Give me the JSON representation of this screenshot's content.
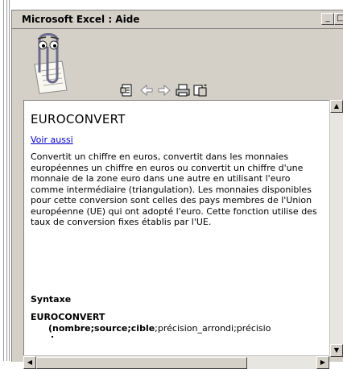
{
  "window": {
    "title": "Microsoft Excel : Aide"
  },
  "toolbar": {
    "buttons": [
      {
        "name": "hide-tabs-icon"
      },
      {
        "name": "back-icon"
      },
      {
        "name": "forward-icon"
      },
      {
        "name": "print-icon"
      },
      {
        "name": "options-icon"
      }
    ]
  },
  "topic": {
    "title": "EUROCONVERT",
    "see_also": "Voir aussi",
    "description": "Convertit un chiffre en euros, convertit dans les monnaies européennes un chiffre en euros ou convertit un chiffre d'une monnaie de la zone euro dans une autre en utilisant l'euro comme intermédiaire (triangulation). Les monnaies disponibles pour cette conversion sont celles des pays membres de l'Union européenne (UE) qui ont adopté l'euro. Cette fonction utilise des taux de conversion fixes établis par l'UE.",
    "syntax_heading": "Syntaxe",
    "function_name": "EUROCONVERT",
    "args_bold": "(nombre;source;cible",
    "args_regular": ";précision_arrondi;précisio"
  }
}
